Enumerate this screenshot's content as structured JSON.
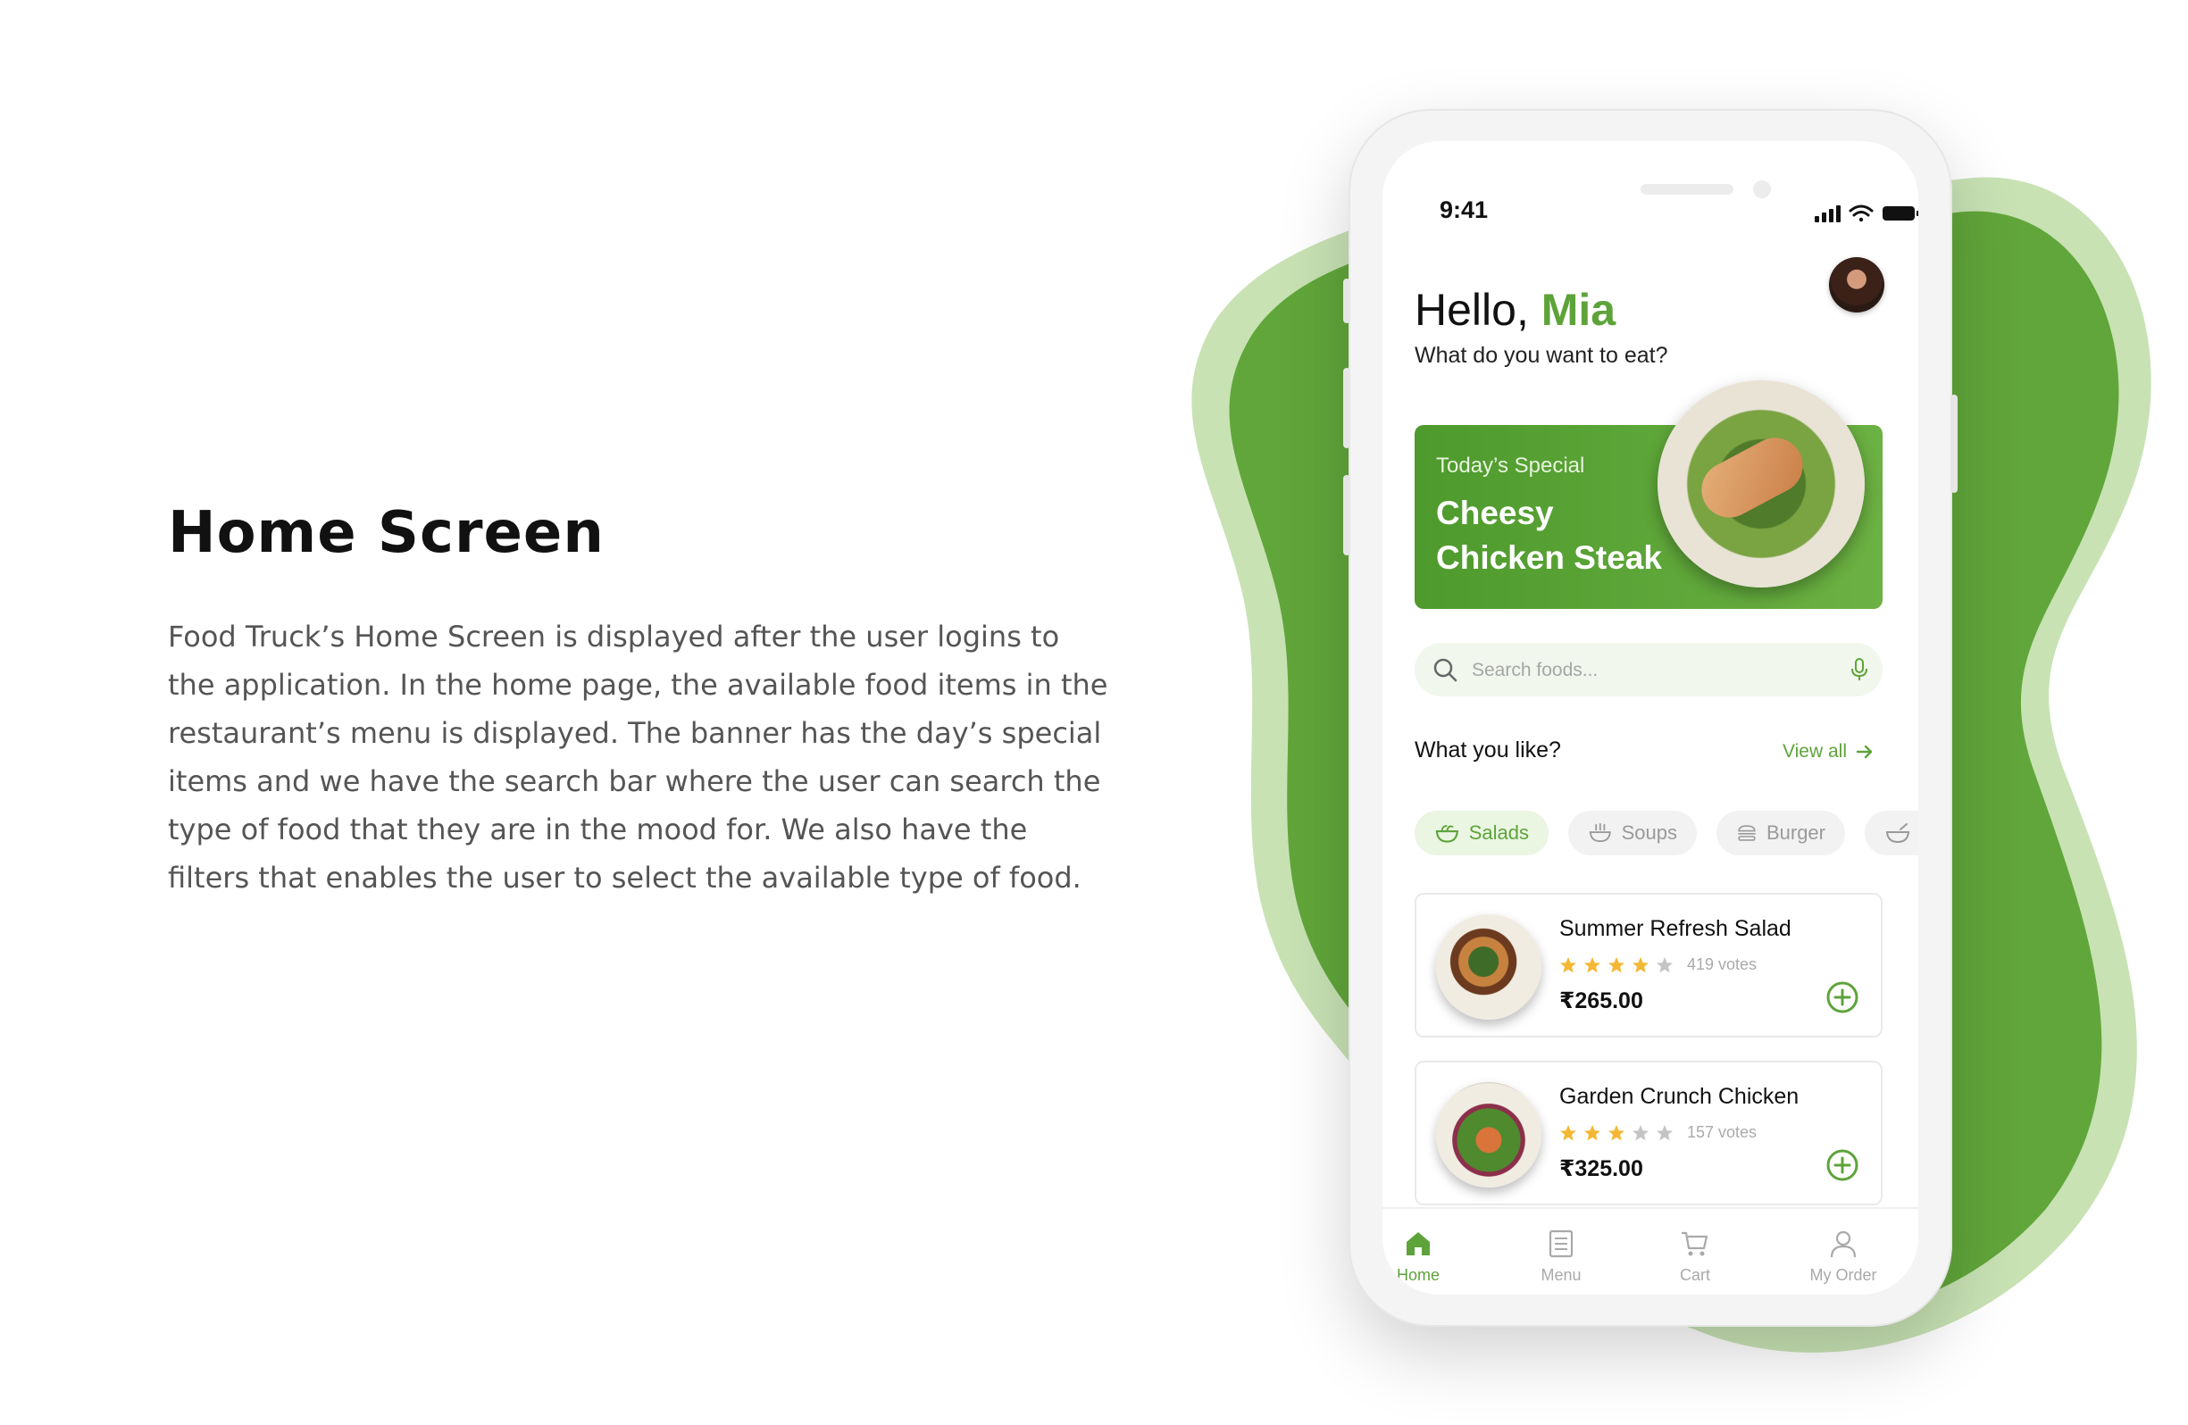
{
  "page": {
    "title": "Home Screen",
    "description": "Food Truck’s Home Screen is displayed after the user logins to the application. In the home page, the available food items in the restaurant’s menu is displayed. The banner has the day’s special items and we have the search bar where the user can search the type of food that they are in the mood for. We also have the filters that enables the user to select the available type of food."
  },
  "colors": {
    "accent": "#5ea33a",
    "accent_light": "#c8e2b4",
    "star": "#f4b732",
    "star_empty": "#c4c4c4"
  },
  "status_bar": {
    "time": "9:41",
    "icons": [
      "signal-icon",
      "wifi-icon",
      "battery-icon"
    ]
  },
  "header": {
    "greeting": "Hello,",
    "user_name": "Mia",
    "subtitle": "What do you want to eat?"
  },
  "banner": {
    "label": "Today’s  Special",
    "title": "Cheesy Chicken Steak"
  },
  "search": {
    "placeholder": "Search foods..."
  },
  "section": {
    "title": "What you like?",
    "view_all": "View all"
  },
  "categories": [
    {
      "label": "Salads",
      "icon": "salad-bowl-icon",
      "active": true
    },
    {
      "label": "Soups",
      "icon": "soup-icon",
      "active": false
    },
    {
      "label": "Burger",
      "icon": "burger-icon",
      "active": false
    },
    {
      "label": "",
      "icon": "bowl-icon",
      "active": false
    }
  ],
  "foods": [
    {
      "name": "Summer Refresh Salad",
      "rating": 4,
      "votes": "419 votes",
      "price": "₹265.00"
    },
    {
      "name": "Garden Crunch Chicken",
      "rating": 3,
      "votes": "157 votes",
      "price": "₹325.00"
    }
  ],
  "bottom_nav": [
    {
      "label": "Home",
      "icon": "home-icon",
      "active": true
    },
    {
      "label": "Menu",
      "icon": "menu-icon",
      "active": false
    },
    {
      "label": "Cart",
      "icon": "cart-icon",
      "active": false
    },
    {
      "label": "My Order",
      "icon": "user-icon",
      "active": false
    }
  ]
}
